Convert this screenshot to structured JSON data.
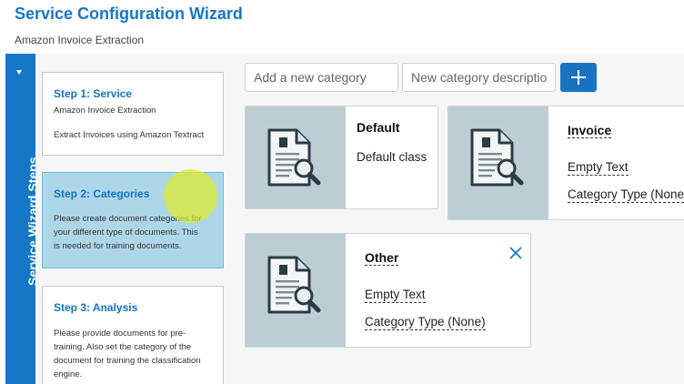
{
  "header": {
    "title": "Service Configuration Wizard",
    "subtitle": "Amazon Invoice Extraction"
  },
  "sidebar": {
    "label": "Service Wizard Steps",
    "collapse_icon": "caret-down-icon"
  },
  "steps": [
    {
      "title": "Step 1: Service",
      "lines": [
        "Amazon Invoice Extraction",
        "Extract Invoices using Amazon Textract"
      ],
      "active": false
    },
    {
      "title": "Step 2: Categories",
      "lines": [
        "Please create document categories for",
        "your different type of documents. This",
        "is needed for training documents."
      ],
      "active": true
    },
    {
      "title": "Step 3: Analysis",
      "lines": [
        "Please provide documents for pre-",
        "training. Also set the category of the",
        "document for training the classification",
        "engine."
      ],
      "active": false
    }
  ],
  "category_form": {
    "name_placeholder": "Add a new category",
    "description_placeholder": "New category description",
    "add_icon": "plus-icon"
  },
  "categories": [
    {
      "name": "Default",
      "lines": [
        "Default class"
      ],
      "icon": "document-search-icon",
      "removable": false
    },
    {
      "name": "Invoice",
      "lines": [
        "Empty Text",
        "Category Type (None)"
      ],
      "icon": "document-search-icon",
      "removable": false
    },
    {
      "name": "Other",
      "lines": [
        "Empty Text",
        "Category Type (None)"
      ],
      "icon": "document-search-icon",
      "removable": true
    }
  ],
  "colors": {
    "accent": "#1776c6",
    "active_step": "#add7e8",
    "card_image_bg": "#bccdd4"
  }
}
